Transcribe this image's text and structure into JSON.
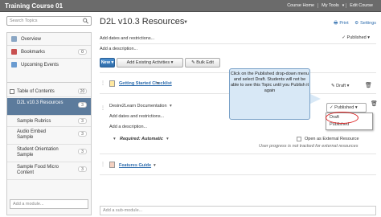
{
  "topbar": {
    "title": "Training Course 01",
    "nav": [
      "Course Home",
      "My Tools",
      "Edit Course"
    ]
  },
  "sidebar": {
    "search_placeholder": "Search Topics",
    "items": [
      {
        "label": "Overview"
      },
      {
        "label": "Bookmarks",
        "count": "0"
      },
      {
        "label": "Upcoming Events"
      }
    ],
    "toc": {
      "label": "Table of Contents",
      "count": "20",
      "items": [
        {
          "label": "D2L v10.3 Resources",
          "count": "3",
          "active": true
        },
        {
          "label": "Sample Rubrics",
          "count": "3"
        },
        {
          "label": "Audio Embed Sample",
          "count": "3"
        },
        {
          "label": "Student Orientation Sample",
          "count": "3"
        },
        {
          "label": "Sample Food Micro Content",
          "count": "3"
        }
      ],
      "add_module": "Add a module..."
    }
  },
  "main": {
    "title": "D2L v10.3 Resources",
    "print": "Print",
    "settings": "Settings",
    "published": "Published",
    "add_dates": "Add dates and restrictions...",
    "add_description": "Add a description...",
    "buttons": {
      "new": "New",
      "add_existing": "Add Existing Activities",
      "bulk_edit": "Bulk Edit"
    },
    "items": [
      {
        "label": "Getting Started Checklist",
        "status": "Draft"
      },
      {
        "label": "Desire2Learn Documentation",
        "requirement": "Required: Automatic",
        "external_label": "Open as External Resource",
        "note": "User progress is not tracked for external resources"
      },
      {
        "label": "Features Guide"
      }
    ],
    "dropdown": {
      "selected": "Published",
      "options": [
        "Draft",
        "Published"
      ]
    },
    "callout": "Click on the Published drop-down menu and select Draft. Students will not be able to see this Topic until you Publish it again",
    "add_submodule": "Add a sub-module..."
  },
  "colors": {
    "topbar": "#6b6b6b",
    "active_toc": "#5c7b9c",
    "new_button": "#2e6ba8",
    "link": "#2d6cad",
    "callout": "#d8e8f6",
    "highlight_ring": "#dd2222"
  }
}
